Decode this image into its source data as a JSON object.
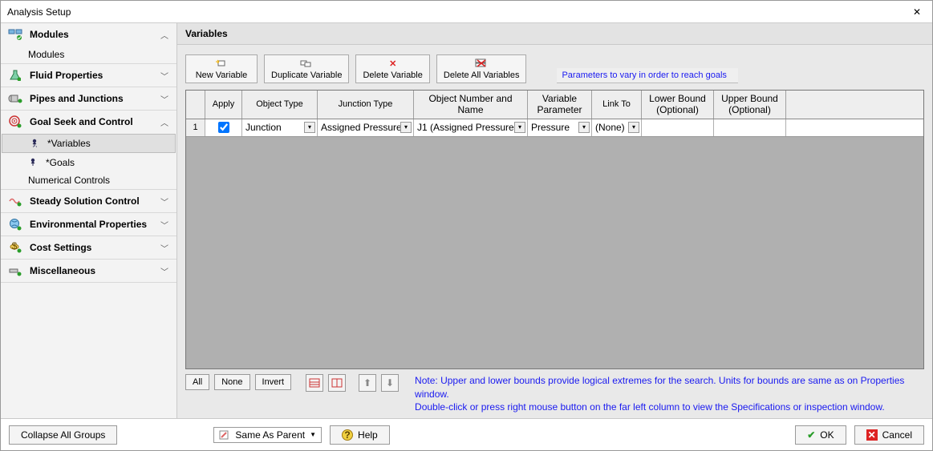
{
  "window": {
    "title": "Analysis Setup"
  },
  "sidebar": {
    "sections": [
      {
        "label": "Modules",
        "expanded": true,
        "items": [
          {
            "label": "Modules"
          }
        ]
      },
      {
        "label": "Fluid Properties",
        "expanded": false
      },
      {
        "label": "Pipes and Junctions",
        "expanded": false
      },
      {
        "label": "Goal Seek and Control",
        "expanded": true,
        "items": [
          {
            "label": "*Variables",
            "selected": true
          },
          {
            "label": "*Goals"
          },
          {
            "label": "Numerical Controls"
          }
        ]
      },
      {
        "label": "Steady Solution Control",
        "expanded": false
      },
      {
        "label": "Environmental Properties",
        "expanded": false
      },
      {
        "label": "Cost Settings",
        "expanded": false
      },
      {
        "label": "Miscellaneous",
        "expanded": false
      }
    ]
  },
  "panel": {
    "title": "Variables",
    "toolbar": {
      "new": "New Variable",
      "dup": "Duplicate Variable",
      "del": "Delete Variable",
      "delall": "Delete All Variables",
      "caption": "Parameters to vary in order to reach goals"
    },
    "grid": {
      "headers": {
        "num": "",
        "apply": "Apply",
        "object_type": "Object Type",
        "junction_type": "Junction Type",
        "object_number": "Object Number and Name",
        "variable_parameter": "Variable Parameter",
        "link_to": "Link To",
        "lower_bound": "Lower Bound (Optional)",
        "upper_bound": "Upper Bound (Optional)"
      },
      "rows": [
        {
          "num": "1",
          "apply": true,
          "object_type": "Junction",
          "junction_type": "Assigned Pressure",
          "object_number": "J1 (Assigned Pressure)",
          "variable_parameter": "Pressure",
          "link_to": "(None)",
          "lower_bound": "",
          "upper_bound": ""
        }
      ]
    },
    "under": {
      "all": "All",
      "none": "None",
      "invert": "Invert",
      "note_line1": "Note: Upper and lower bounds provide logical extremes for the search. Units for bounds are same as on Properties window.",
      "note_line2": "Double-click or press right mouse button on the far left column to view the Specifications or inspection window."
    }
  },
  "footer": {
    "collapse": "Collapse All Groups",
    "same_as_parent": "Same As Parent",
    "help": "Help",
    "ok": "OK",
    "cancel": "Cancel"
  }
}
